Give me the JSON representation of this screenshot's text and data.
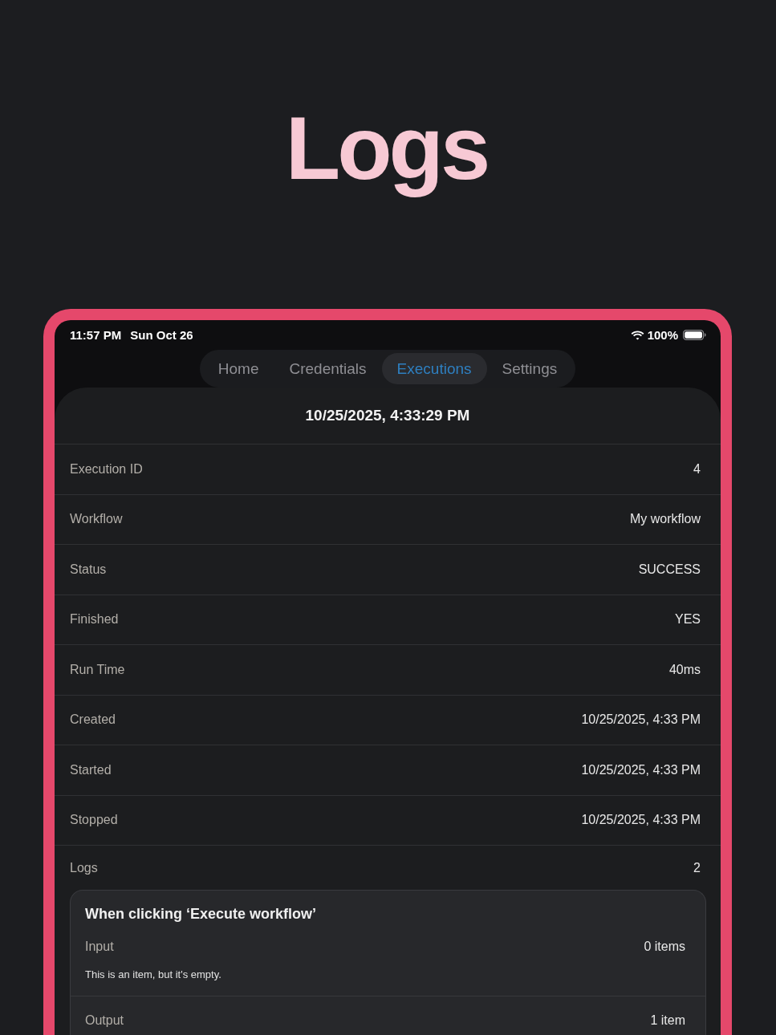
{
  "page_title": "Logs",
  "status_bar": {
    "time": "11:57 PM",
    "date": "Sun Oct 26",
    "battery": "100%"
  },
  "tabs": [
    {
      "label": "Home",
      "selected": false
    },
    {
      "label": "Credentials",
      "selected": false
    },
    {
      "label": "Executions",
      "selected": true
    },
    {
      "label": "Settings",
      "selected": false
    }
  ],
  "execution": {
    "title": "10/25/2025, 4:33:29 PM",
    "fields": [
      {
        "label": "Execution ID",
        "value": "4"
      },
      {
        "label": "Workflow",
        "value": "My workflow"
      },
      {
        "label": "Status",
        "value": "SUCCESS"
      },
      {
        "label": "Finished",
        "value": "YES"
      },
      {
        "label": "Run Time",
        "value": "40ms"
      },
      {
        "label": "Created",
        "value": "10/25/2025, 4:33 PM"
      },
      {
        "label": "Started",
        "value": "10/25/2025, 4:33 PM"
      },
      {
        "label": "Stopped",
        "value": "10/25/2025, 4:33 PM"
      }
    ],
    "logs": {
      "label": "Logs",
      "count": "2",
      "entries": [
        {
          "title": "When clicking ‘Execute workflow’",
          "sections": [
            {
              "label": "Input",
              "count": "0 items",
              "note": "This is an item, but it's empty."
            },
            {
              "label": "Output",
              "count": "1 item"
            }
          ]
        }
      ]
    }
  }
}
